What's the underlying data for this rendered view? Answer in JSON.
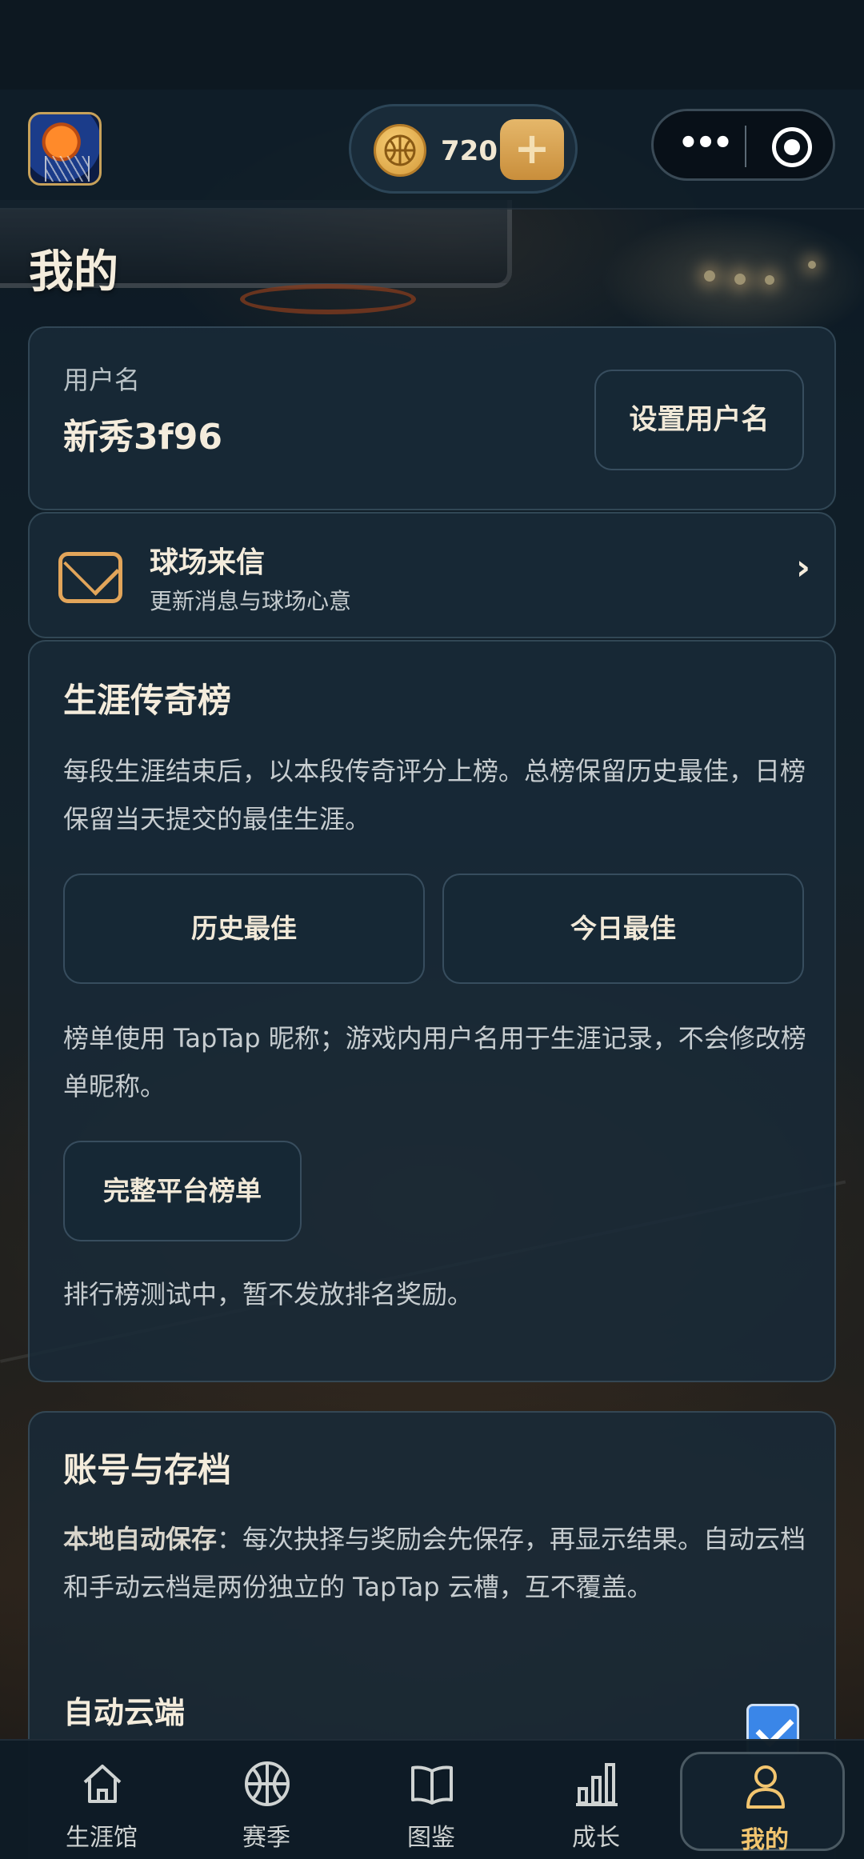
{
  "header": {
    "coins": "720",
    "add_label": "+",
    "more_label": "•••"
  },
  "page": {
    "title": "我的"
  },
  "user_card": {
    "label": "用户名",
    "name": "新秀3f96",
    "set_name_button": "设置用户名"
  },
  "mail_card": {
    "title": "球场来信",
    "subtitle": "更新消息与球场心意",
    "chevron": "›"
  },
  "rank_card": {
    "title": "生涯传奇榜",
    "description": "每段生涯结束后，以本段传奇评分上榜。总榜保留历史最佳，日榜保留当天提交的最佳生涯。",
    "history_best_button": "历史最佳",
    "today_best_button": "今日最佳",
    "nickname_note": "榜单使用 TapTap 昵称；游戏内用户名用于生涯记录，不会修改榜单昵称。",
    "full_board_button": "完整平台榜单",
    "test_note": "排行榜测试中，暂不发放排名奖励。"
  },
  "account_card": {
    "title": "账号与存档",
    "save_label": "本地自动保存",
    "save_text": "：每次抉择与奖励会先保存，再显示结果。自动云档和手动云档是两份独立的 TapTap 云槽，互不覆盖。",
    "auto_cloud_label": "自动云端",
    "auto_cloud_checked": true
  },
  "tabbar": {
    "items": [
      {
        "label": "生涯馆",
        "icon": "home-icon"
      },
      {
        "label": "赛季",
        "icon": "basketball-icon"
      },
      {
        "label": "图鉴",
        "icon": "book-icon"
      },
      {
        "label": "成长",
        "icon": "bar-chart-icon"
      },
      {
        "label": "我的",
        "icon": "user-icon",
        "active": true
      }
    ]
  },
  "colors": {
    "accent": "#f2c56f",
    "mail_icon": "#e2a55a",
    "checkbox": "#3a86e8"
  }
}
